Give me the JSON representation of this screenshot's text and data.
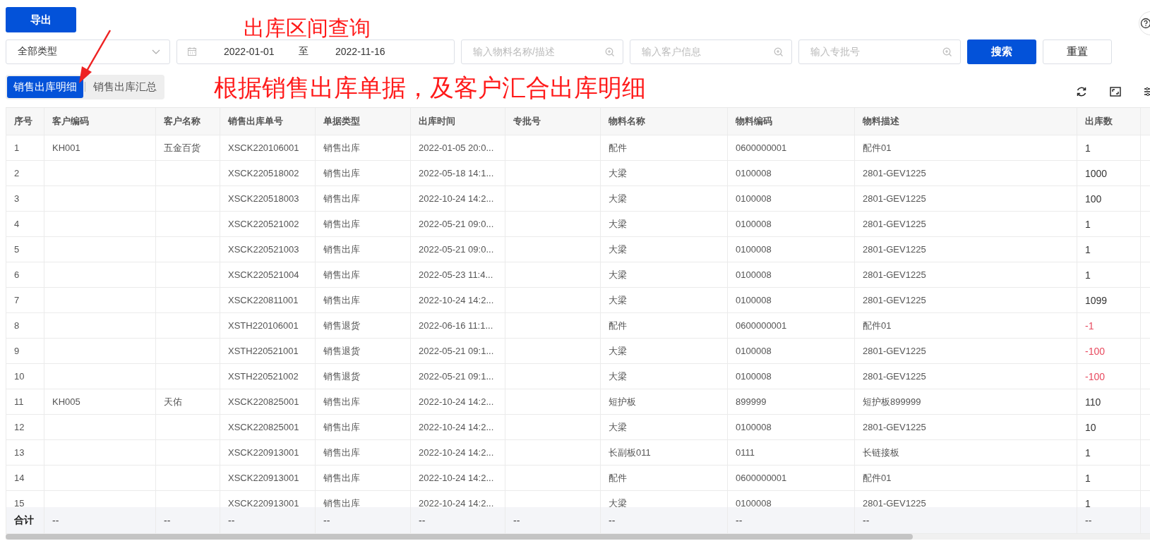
{
  "toolbar": {
    "export_button": "导出"
  },
  "filters": {
    "type_select": "全部类型",
    "date_from": "2022-01-01",
    "date_separator": "至",
    "date_to": "2022-11-16",
    "inputs": [
      {
        "placeholder": "输入物料名称/描述"
      },
      {
        "placeholder": "输入客户信息"
      },
      {
        "placeholder": "输入专批号"
      }
    ],
    "search_button": "搜索",
    "reset_button": "重置"
  },
  "tabs": [
    {
      "label": "销售出库明细",
      "selected": true
    },
    {
      "label": "销售出库汇总",
      "selected": false
    }
  ],
  "annotations": [
    {
      "kind": "title",
      "text": "出库区间查询"
    },
    {
      "kind": "note",
      "text": "根据销售出库单据，及客户汇合出库明细"
    },
    {
      "kind": "arrow"
    }
  ],
  "table": {
    "columns": [
      "序号",
      "客户编码",
      "客户名称",
      "销售出库单号",
      "单据类型",
      "出库时间",
      "专批号",
      "物料名称",
      "物料编码",
      "物料描述",
      "出库数"
    ],
    "rows": [
      {
        "cells": [
          "1",
          "KH001",
          "五金百货",
          "XSCK220106001",
          "销售出库",
          "2022-01-05 20:0...",
          null,
          "配件",
          "0600000001",
          "配件01",
          "1"
        ],
        "negative": false
      },
      {
        "cells": [
          "2",
          null,
          null,
          "XSCK220518002",
          "销售出库",
          "2022-05-18 14:1...",
          null,
          "大梁",
          "0100008",
          "2801-GEV1225",
          "1000"
        ],
        "negative": false
      },
      {
        "cells": [
          "3",
          null,
          null,
          "XSCK220518003",
          "销售出库",
          "2022-10-24 14:2...",
          null,
          "大梁",
          "0100008",
          "2801-GEV1225",
          "100"
        ],
        "negative": false
      },
      {
        "cells": [
          "4",
          null,
          null,
          "XSCK220521002",
          "销售出库",
          "2022-05-21 09:0...",
          null,
          "大梁",
          "0100008",
          "2801-GEV1225",
          "1"
        ],
        "negative": false
      },
      {
        "cells": [
          "5",
          null,
          null,
          "XSCK220521003",
          "销售出库",
          "2022-05-21 09:0...",
          null,
          "大梁",
          "0100008",
          "2801-GEV1225",
          "1"
        ],
        "negative": false
      },
      {
        "cells": [
          "6",
          null,
          null,
          "XSCK220521004",
          "销售出库",
          "2022-05-23 11:4...",
          null,
          "大梁",
          "0100008",
          "2801-GEV1225",
          "1"
        ],
        "negative": false
      },
      {
        "cells": [
          "7",
          null,
          null,
          "XSCK220811001",
          "销售出库",
          "2022-10-24 14:2...",
          null,
          "大梁",
          "0100008",
          "2801-GEV1225",
          "1099"
        ],
        "negative": false
      },
      {
        "cells": [
          "8",
          null,
          null,
          "XSTH220106001",
          "销售退货",
          "2022-06-16 11:1...",
          null,
          "配件",
          "0600000001",
          "配件01",
          "-1"
        ],
        "negative": true
      },
      {
        "cells": [
          "9",
          null,
          null,
          "XSTH220521001",
          "销售退货",
          "2022-05-21 09:1...",
          null,
          "大梁",
          "0100008",
          "2801-GEV1225",
          "-100"
        ],
        "negative": true
      },
      {
        "cells": [
          "10",
          null,
          null,
          "XSTH220521002",
          "销售退货",
          "2022-05-21 09:1...",
          null,
          "大梁",
          "0100008",
          "2801-GEV1225",
          "-100"
        ],
        "negative": true
      },
      {
        "cells": [
          "11",
          "KH005",
          "天佑",
          "XSCK220825001",
          "销售出库",
          "2022-10-24 14:2...",
          null,
          "短护板",
          "899999",
          "短护板899999",
          "110"
        ],
        "negative": false
      },
      {
        "cells": [
          "12",
          null,
          null,
          "XSCK220825001",
          "销售出库",
          "2022-10-24 14:2...",
          null,
          "大梁",
          "0100008",
          "2801-GEV1225",
          "10"
        ],
        "negative": false
      },
      {
        "cells": [
          "13",
          null,
          null,
          "XSCK220913001",
          "销售出库",
          "2022-10-24 14:2...",
          null,
          "长副板011",
          "0111",
          "长链接板",
          "1"
        ],
        "negative": false
      },
      {
        "cells": [
          "14",
          null,
          null,
          "XSCK220913001",
          "销售出库",
          "2022-10-24 14:2...",
          null,
          "配件",
          "0600000001",
          "配件01",
          "1"
        ],
        "negative": false
      },
      {
        "cells": [
          "15",
          null,
          null,
          "XSCK220913001",
          "销售出库",
          "2022-10-24 14:2...",
          null,
          "大梁",
          "0100008",
          "2801-GEV1225",
          "1"
        ],
        "negative": false
      }
    ],
    "footer": [
      "合计",
      "--",
      "--",
      "--",
      "--",
      "--",
      "--",
      "--",
      "--",
      "--",
      "--"
    ]
  }
}
